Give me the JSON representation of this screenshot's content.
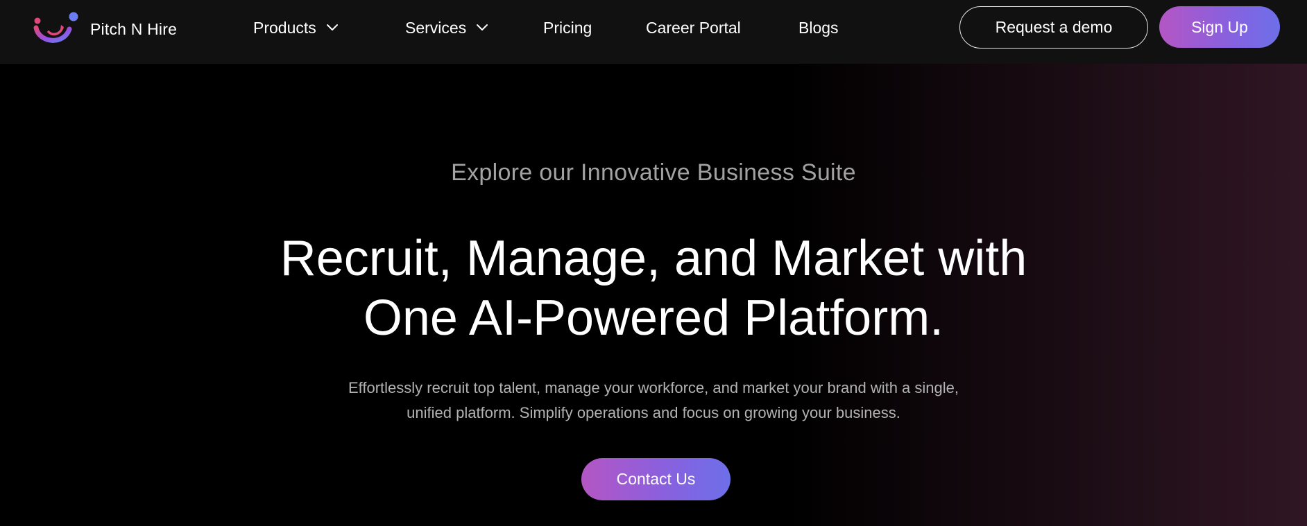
{
  "brand": {
    "name": "Pitch N Hire",
    "logo_icon": "pitchnhire-logo-icon",
    "logo_colors": [
      "#e0477a",
      "#7a5cf0",
      "#6a7df2"
    ]
  },
  "nav": {
    "items": [
      {
        "label": "Products",
        "has_dropdown": true
      },
      {
        "label": "Services",
        "has_dropdown": true
      },
      {
        "label": "Pricing",
        "has_dropdown": false
      },
      {
        "label": "Career Portal",
        "has_dropdown": false
      },
      {
        "label": "Blogs",
        "has_dropdown": false
      }
    ],
    "demo_label": "Request a demo",
    "signup_label": "Sign Up"
  },
  "hero": {
    "eyebrow": "Explore our Innovative Business Suite",
    "headline_line1": "Recruit, Manage, and Market with",
    "headline_line2": "One AI-Powered Platform.",
    "subtext_line1": "Effortlessly recruit top talent, manage your workforce, and market your brand with a single,",
    "subtext_line2": "unified platform. Simplify operations and focus on growing your business.",
    "cta_label": "Contact Us"
  },
  "colors": {
    "navbar_bg": "#111111",
    "page_bg": "#000000",
    "accent_gradient_start": "#b456c4",
    "accent_gradient_end": "#6d6fe9",
    "muted_text": "#a3a3a3"
  }
}
